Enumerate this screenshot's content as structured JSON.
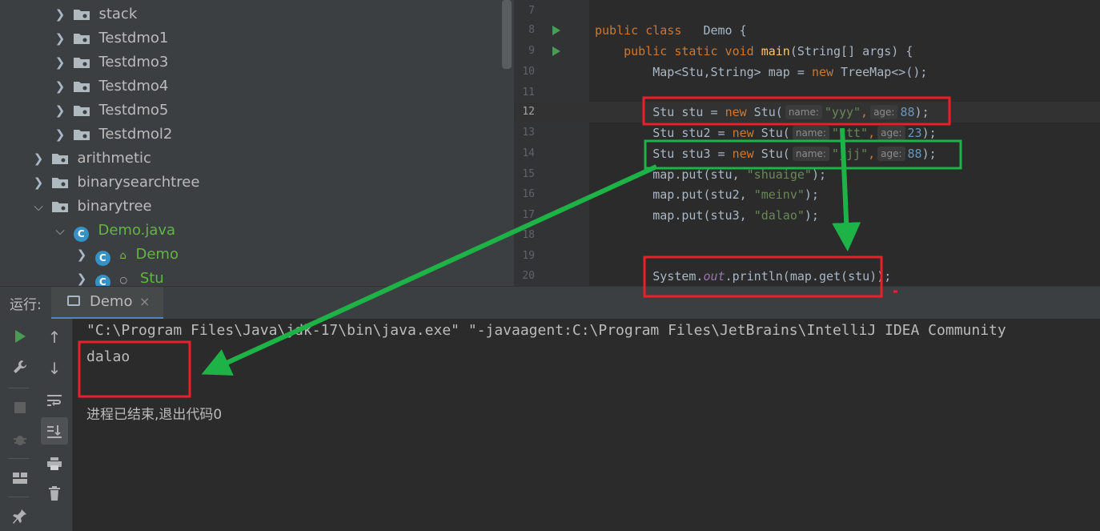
{
  "project_tree": {
    "items": [
      {
        "label": "stack",
        "type": "package",
        "expanded": false
      },
      {
        "label": "Testdmo1",
        "type": "package",
        "expanded": false
      },
      {
        "label": "Testdmo3",
        "type": "package",
        "expanded": false
      },
      {
        "label": "Testdmo4",
        "type": "package",
        "expanded": false
      },
      {
        "label": "Testdmo5",
        "type": "package",
        "expanded": false
      },
      {
        "label": "Testdmol2",
        "type": "package",
        "expanded": false
      },
      {
        "label": "arithmetic",
        "type": "package",
        "expanded": false
      },
      {
        "label": "binarysearchtree",
        "type": "package",
        "expanded": false
      },
      {
        "label": "binarytree",
        "type": "package",
        "expanded": true
      },
      {
        "label": "Demo.java",
        "type": "file",
        "expanded": true
      },
      {
        "label": "Demo",
        "type": "class",
        "expanded": false
      },
      {
        "label": "Stu",
        "type": "class",
        "expanded": false
      }
    ]
  },
  "editor": {
    "line_numbers": [
      "7",
      "8",
      "9",
      "10",
      "11",
      "12",
      "13",
      "14",
      "15",
      "16",
      "17",
      "18",
      "19",
      "20"
    ],
    "l8": {
      "kw": "public class",
      "name": "Demo",
      "brace": "{"
    },
    "l9": {
      "kw": "public static void",
      "fn": "main",
      "args": "(String[] args) {"
    },
    "l10": {
      "a": "Map<Stu,String> map = ",
      "kw": "new",
      "b": " TreeMap<>();"
    },
    "l12": {
      "a": "Stu stu = ",
      "kw": "new",
      "b": " Stu(",
      "hint1": "name:",
      "s": "\"yyy\"",
      "comma": ",",
      "hint2": "age:",
      "n": "88",
      "c": ");"
    },
    "l13": {
      "a": "Stu stu2 = ",
      "kw": "new",
      "b": " Stu(",
      "hint1": "name:",
      "s": "\"ttt\"",
      "comma": ",",
      "hint2": "age:",
      "n": "23",
      "c": ");"
    },
    "l14": {
      "a": "Stu stu3 = ",
      "kw": "new",
      "b": " Stu(",
      "hint1": "name:",
      "s": "\"jjj\"",
      "comma": ",",
      "hint2": "age:",
      "n": "88",
      "c": ");"
    },
    "l15": {
      "a": "map.put(stu, ",
      "s": "\"shuaige\"",
      "c": ");"
    },
    "l16": {
      "a": "map.put(stu2, ",
      "s": "\"meinv\"",
      "c": ");"
    },
    "l17": {
      "a": "map.put(stu3, ",
      "s": "\"dalao\"",
      "c": ");"
    },
    "l20": {
      "a": "System.",
      "fld": "out",
      "b": ".println(map.get(stu));"
    }
  },
  "run_panel": {
    "label": "运行:",
    "tab_label": "Demo",
    "tab_close": "×",
    "console_lines": [
      "\"C:\\Program Files\\Java\\jdk-17\\bin\\java.exe\" \"-javaagent:C:\\Program Files\\JetBrains\\IntelliJ IDEA Community",
      "dalao",
      "进程已结束,退出代码0"
    ]
  },
  "colors": {
    "highlight_red": "#e8202a",
    "highlight_green": "#1db347",
    "accent": "#4a88c7"
  }
}
